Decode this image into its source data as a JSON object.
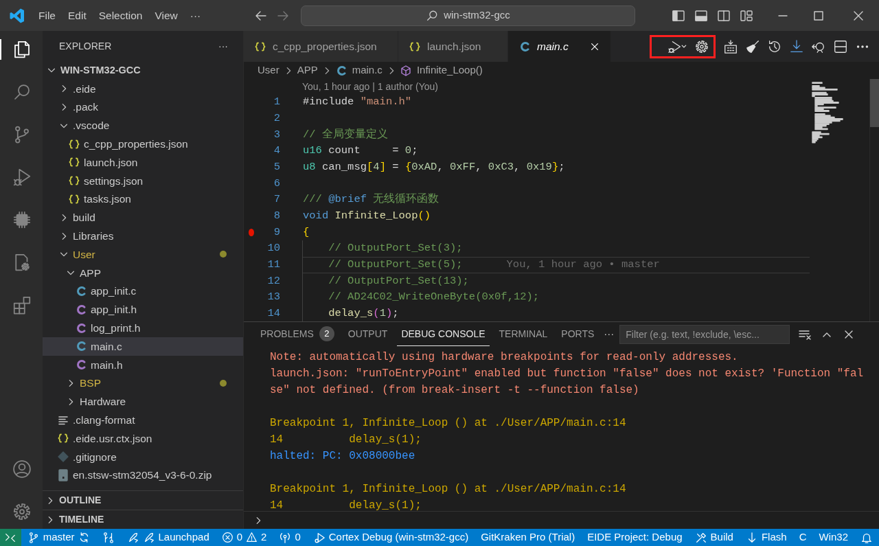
{
  "title_bar": {
    "menu": [
      "File",
      "Edit",
      "Selection",
      "View",
      "···"
    ],
    "search": "win-stm32-gcc"
  },
  "activity_bar": {
    "top": [
      {
        "kind": "explorer",
        "selected": true
      },
      {
        "kind": "search",
        "selected": false
      },
      {
        "kind": "source-control",
        "selected": false
      },
      {
        "kind": "run-debug",
        "selected": false
      },
      {
        "kind": "chip",
        "selected": false
      },
      {
        "kind": "eide",
        "selected": false
      },
      {
        "kind": "extensions",
        "selected": false
      }
    ],
    "bottom": [
      {
        "kind": "account",
        "selected": false
      },
      {
        "kind": "settings",
        "selected": false
      }
    ]
  },
  "explorer": {
    "title": "EXPLORER",
    "more": "···",
    "root": {
      "label": "WIN-STM32-GCC",
      "expanded": true
    },
    "items": [
      {
        "label": ".eide",
        "kind": "folder",
        "expanded": false,
        "modified": false,
        "selected": false
      },
      {
        "label": ".pack",
        "kind": "folder",
        "expanded": false,
        "modified": false,
        "selected": false
      },
      {
        "label": ".vscode",
        "kind": "folder",
        "expanded": true,
        "modified": false,
        "selected": false,
        "children": [
          {
            "label": "c_cpp_properties.json",
            "kind": "json",
            "modified": false,
            "selected": false
          },
          {
            "label": "launch.json",
            "kind": "json",
            "modified": false,
            "selected": false
          },
          {
            "label": "settings.json",
            "kind": "json",
            "modified": false,
            "selected": false
          },
          {
            "label": "tasks.json",
            "kind": "json",
            "modified": false,
            "selected": false
          }
        ]
      },
      {
        "label": "build",
        "kind": "folder",
        "expanded": false,
        "modified": false,
        "selected": false
      },
      {
        "label": "Libraries",
        "kind": "folder",
        "expanded": false,
        "modified": false,
        "selected": false
      },
      {
        "label": "User",
        "kind": "folder",
        "expanded": true,
        "modified": true,
        "selected": false,
        "children": [
          {
            "label": "APP",
            "kind": "folder",
            "expanded": true,
            "modified": false,
            "selected": false,
            "children": [
              {
                "label": "app_init.c",
                "kind": "c-source",
                "modified": false,
                "selected": false
              },
              {
                "label": "app_init.h",
                "kind": "c-header",
                "modified": false,
                "selected": false
              },
              {
                "label": "log_print.h",
                "kind": "c-header",
                "modified": false,
                "selected": false
              },
              {
                "label": "main.c",
                "kind": "c-source",
                "modified": false,
                "selected": true
              },
              {
                "label": "main.h",
                "kind": "c-header",
                "modified": false,
                "selected": false
              }
            ]
          },
          {
            "label": "BSP",
            "kind": "folder",
            "expanded": false,
            "modified": true,
            "selected": false
          },
          {
            "label": "Hardware",
            "kind": "folder",
            "expanded": false,
            "modified": false,
            "selected": false
          }
        ]
      },
      {
        "label": ".clang-format",
        "kind": "text",
        "modified": false,
        "selected": false
      },
      {
        "label": ".eide.usr.ctx.json",
        "kind": "json",
        "modified": false,
        "selected": false
      },
      {
        "label": ".gitignore",
        "kind": "git",
        "modified": false,
        "selected": false
      },
      {
        "label": "en.stsw-stm32054_v3-6-0.zip",
        "kind": "archive",
        "modified": false,
        "selected": false
      }
    ],
    "sections": [
      {
        "label": "OUTLINE",
        "expanded": false
      },
      {
        "label": "TIMELINE",
        "expanded": false
      }
    ]
  },
  "editor": {
    "tabs": [
      {
        "label": "c_cpp_properties.json",
        "kind": "json",
        "selected": false,
        "preview": false
      },
      {
        "label": "launch.json",
        "kind": "json",
        "selected": false,
        "preview": false
      },
      {
        "label": "main.c",
        "kind": "c-source",
        "selected": true,
        "preview": true
      }
    ],
    "toolbar": {
      "framed": [
        {
          "kind": "run-debug"
        },
        {
          "kind": "gear"
        }
      ],
      "buttons": [
        {
          "kind": "build"
        },
        {
          "kind": "broom"
        },
        {
          "kind": "history"
        },
        {
          "kind": "download"
        },
        {
          "kind": "probe"
        },
        {
          "kind": "split"
        },
        {
          "kind": "more"
        }
      ]
    },
    "breadcrumbs": [
      {
        "label": "User",
        "kind": "folder"
      },
      {
        "label": "APP",
        "kind": "folder"
      },
      {
        "label": "main.c",
        "kind": "c-source"
      },
      {
        "label": "Infinite_Loop()",
        "kind": "function"
      }
    ],
    "codelens": "You, 1 hour ago | 1 author (You)",
    "lines": [
      {
        "number": "1",
        "breakpoint": false,
        "current": false,
        "tokens": [
          {
            "text": "#include ",
            "kind": "plain"
          },
          {
            "text": "\"main.h\"",
            "kind": "string"
          }
        ]
      },
      {
        "number": "2",
        "breakpoint": false,
        "current": false
      },
      {
        "number": "3",
        "breakpoint": false,
        "current": false,
        "tokens": [
          {
            "text": "// 全局变量定义",
            "kind": "comment"
          }
        ]
      },
      {
        "number": "4",
        "breakpoint": false,
        "current": false,
        "tokens": [
          {
            "text": "u16",
            "kind": "type"
          },
          {
            "text": " count     = ",
            "kind": "plain"
          },
          {
            "text": "0",
            "kind": "number"
          },
          {
            "text": ";",
            "kind": "plain"
          }
        ]
      },
      {
        "number": "5",
        "breakpoint": false,
        "current": false,
        "tokens": [
          {
            "text": "u8",
            "kind": "type"
          },
          {
            "text": " can_msg",
            "kind": "plain"
          },
          {
            "text": "[",
            "kind": "bracket"
          },
          {
            "text": "4",
            "kind": "number"
          },
          {
            "text": "]",
            "kind": "bracket"
          },
          {
            "text": " = ",
            "kind": "plain"
          },
          {
            "text": "{",
            "kind": "bracket"
          },
          {
            "text": "0xAD",
            "kind": "number"
          },
          {
            "text": ", ",
            "kind": "plain"
          },
          {
            "text": "0xFF",
            "kind": "number"
          },
          {
            "text": ", ",
            "kind": "plain"
          },
          {
            "text": "0xC3",
            "kind": "number"
          },
          {
            "text": ", ",
            "kind": "plain"
          },
          {
            "text": "0x19",
            "kind": "number"
          },
          {
            "text": "}",
            "kind": "bracket"
          },
          {
            "text": ";",
            "kind": "plain"
          }
        ]
      },
      {
        "number": "6",
        "breakpoint": false,
        "current": false
      },
      {
        "number": "7",
        "breakpoint": false,
        "current": false,
        "tokens": [
          {
            "text": "/// ",
            "kind": "comment"
          },
          {
            "text": "@brief",
            "kind": "doc"
          },
          {
            "text": " 无线循环函数",
            "kind": "comment"
          }
        ]
      },
      {
        "number": "8",
        "breakpoint": false,
        "current": false,
        "tokens": [
          {
            "text": "void",
            "kind": "keyword"
          },
          {
            "text": " Infinite_Loop",
            "kind": "function"
          },
          {
            "text": "()",
            "kind": "bracket"
          }
        ]
      },
      {
        "number": "9",
        "breakpoint": true,
        "current": false,
        "tokens": [
          {
            "text": "{",
            "kind": "bracket"
          }
        ]
      },
      {
        "number": "10",
        "breakpoint": false,
        "current": false,
        "tokens": [
          {
            "text": "    // OutputPort_Set(3);",
            "kind": "comment"
          }
        ]
      },
      {
        "number": "11",
        "breakpoint": false,
        "current": true,
        "tokens": [
          {
            "text": "    // OutputPort_Set(5);",
            "kind": "comment"
          }
        ],
        "blame": "You, 1 hour ago • master"
      },
      {
        "number": "12",
        "breakpoint": false,
        "current": false,
        "tokens": [
          {
            "text": "    // OutputPort_Set(13);",
            "kind": "comment"
          }
        ]
      },
      {
        "number": "13",
        "breakpoint": false,
        "current": false,
        "tokens": [
          {
            "text": "    // AD24C02_WriteOneByte(0x0f,12);",
            "kind": "comment"
          }
        ]
      },
      {
        "number": "14",
        "breakpoint": false,
        "current": false,
        "tokens": [
          {
            "text": "    delay_s",
            "kind": "function"
          },
          {
            "text": "(",
            "kind": "bracket2"
          },
          {
            "text": "1",
            "kind": "number"
          },
          {
            "text": ")",
            "kind": "bracket2"
          },
          {
            "text": ";",
            "kind": "plain"
          }
        ]
      }
    ]
  },
  "panel": {
    "tabs": [
      {
        "label": "PROBLEMS",
        "badge": "2",
        "selected": false
      },
      {
        "label": "OUTPUT",
        "selected": false
      },
      {
        "label": "DEBUG CONSOLE",
        "selected": true
      },
      {
        "label": "TERMINAL",
        "selected": false
      },
      {
        "label": "PORTS",
        "selected": false
      }
    ],
    "more": "···",
    "filter": {
      "placeholder": "Filter (e.g. text, !exclude, \\esc..."
    },
    "console": [
      {
        "lines": [
          {
            "text": "Note: automatically using hardware breakpoints for read-only addresses.",
            "kind": "error"
          },
          {
            "text": "launch.json: \"runToEntryPoint\" enabled but function \"false\" does not exist? 'Function \"false\" not defined. (from break-insert -t --function false)",
            "kind": "error"
          }
        ]
      },
      {
        "lines": [
          {
            "text": "Breakpoint 1, Infinite_Loop () at ./User/APP/main.c:14",
            "kind": "output"
          },
          {
            "text": "14          delay_s(1);",
            "kind": "output"
          },
          {
            "text": "halted: PC: 0x08000bee",
            "kind": "info"
          }
        ]
      },
      {
        "lines": [
          {
            "text": "Breakpoint 1, Infinite_Loop () at ./User/APP/main.c:14",
            "kind": "output"
          },
          {
            "text": "14          delay_s(1);",
            "kind": "output"
          }
        ]
      }
    ]
  },
  "status_bar": [
    {
      "kind": "remote"
    },
    {
      "kind": "branch",
      "text": "master"
    },
    {
      "kind": "compare"
    },
    {
      "kind": "launchpad",
      "text": "Launchpad"
    },
    {
      "kind": "problems",
      "errors": "0",
      "warnings": "2"
    },
    {
      "kind": "ports",
      "text": "0"
    },
    {
      "kind": "debug",
      "text": "Cortex Debug (win-stm32-gcc)"
    },
    {
      "kind": "plain",
      "text": "GitKraken Pro (Trial)"
    },
    {
      "kind": "plain",
      "text": "EIDE Project: Debug"
    },
    {
      "kind": "build",
      "text": "Build"
    },
    {
      "kind": "flash",
      "text": "Flash"
    },
    {
      "kind": "plain",
      "text": "C"
    },
    {
      "kind": "plain",
      "text": "Win32"
    },
    {
      "kind": "bell"
    }
  ]
}
